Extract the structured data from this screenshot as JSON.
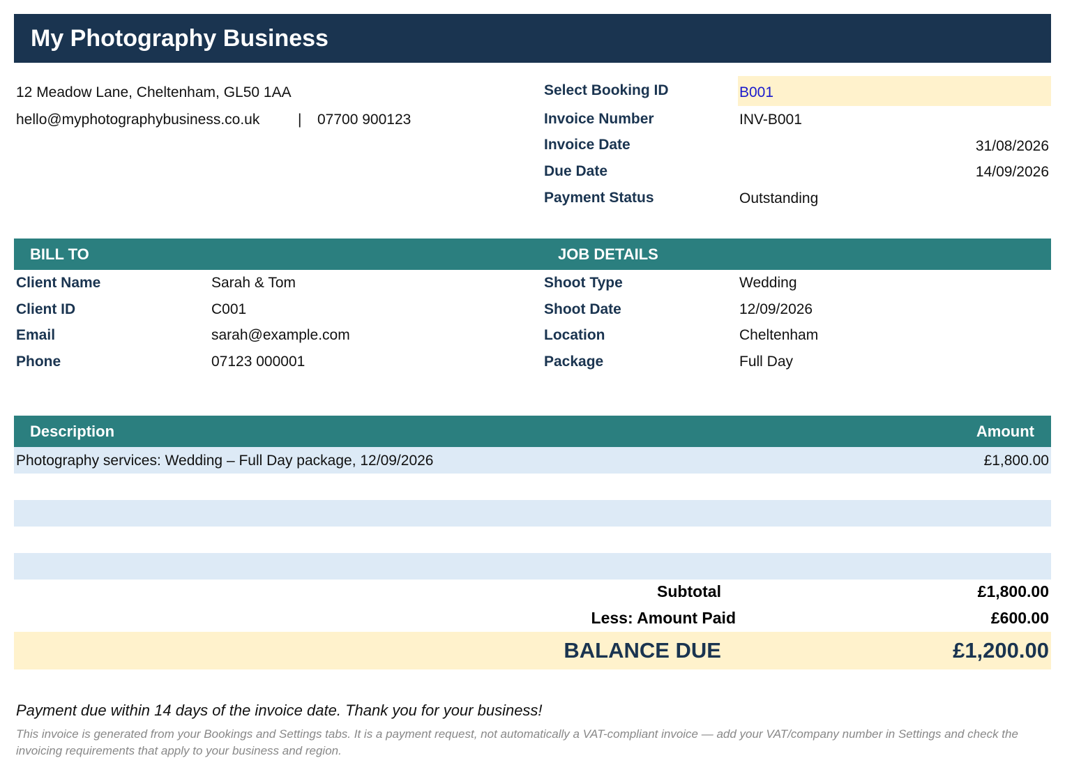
{
  "business": {
    "name": "My Photography Business",
    "address": "12 Meadow Lane, Cheltenham, GL50 1AA",
    "email": "hello@myphotographybusiness.co.uk",
    "separator": "|",
    "phone": "07700 900123"
  },
  "invoice_meta": {
    "booking_label": "Select Booking ID",
    "booking_value": "B001",
    "number_label": "Invoice Number",
    "number_value": "INV-B001",
    "date_label": "Invoice Date",
    "date_value": "31/08/2026",
    "due_label": "Due Date",
    "due_value": "14/09/2026",
    "status_label": "Payment Status",
    "status_value": "Outstanding"
  },
  "bill_to": {
    "header": "BILL TO",
    "fields": [
      {
        "label": "Client Name",
        "value": "Sarah & Tom"
      },
      {
        "label": "Client ID",
        "value": "C001"
      },
      {
        "label": "Email",
        "value": "sarah@example.com"
      },
      {
        "label": "Phone",
        "value": "07123 000001"
      }
    ]
  },
  "job_details": {
    "header": "JOB DETAILS",
    "fields": [
      {
        "label": "Shoot Type",
        "value": "Wedding"
      },
      {
        "label": "Shoot Date",
        "value": "12/09/2026"
      },
      {
        "label": "Location",
        "value": "Cheltenham"
      },
      {
        "label": "Package",
        "value": "Full Day"
      }
    ]
  },
  "line_items": {
    "description_header": "Description",
    "amount_header": "Amount",
    "rows": [
      {
        "description": "Photography services: Wedding – Full Day package, 12/09/2026",
        "amount": "£1,800.00"
      },
      {
        "description": "",
        "amount": ""
      },
      {
        "description": "",
        "amount": ""
      },
      {
        "description": "",
        "amount": ""
      },
      {
        "description": "",
        "amount": ""
      }
    ]
  },
  "totals": {
    "subtotal_label": "Subtotal",
    "subtotal_value": "£1,800.00",
    "paid_label": "Less: Amount Paid",
    "paid_value": "£600.00",
    "balance_label": "BALANCE DUE",
    "balance_value": "£1,200.00"
  },
  "footer": {
    "note": "Payment due within 14 days of the invoice date. Thank you for your business!",
    "disclaimer": "This invoice is generated from your Bookings and Settings tabs. It is a payment request, not automatically a VAT-compliant invoice — add your VAT/company number in Settings and check the invoicing requirements that apply to your business and region."
  },
  "colors": {
    "navy": "#1a3450",
    "teal": "#2b7f7f",
    "highlight": "#fff2cc",
    "band": "#ddeaf6"
  }
}
